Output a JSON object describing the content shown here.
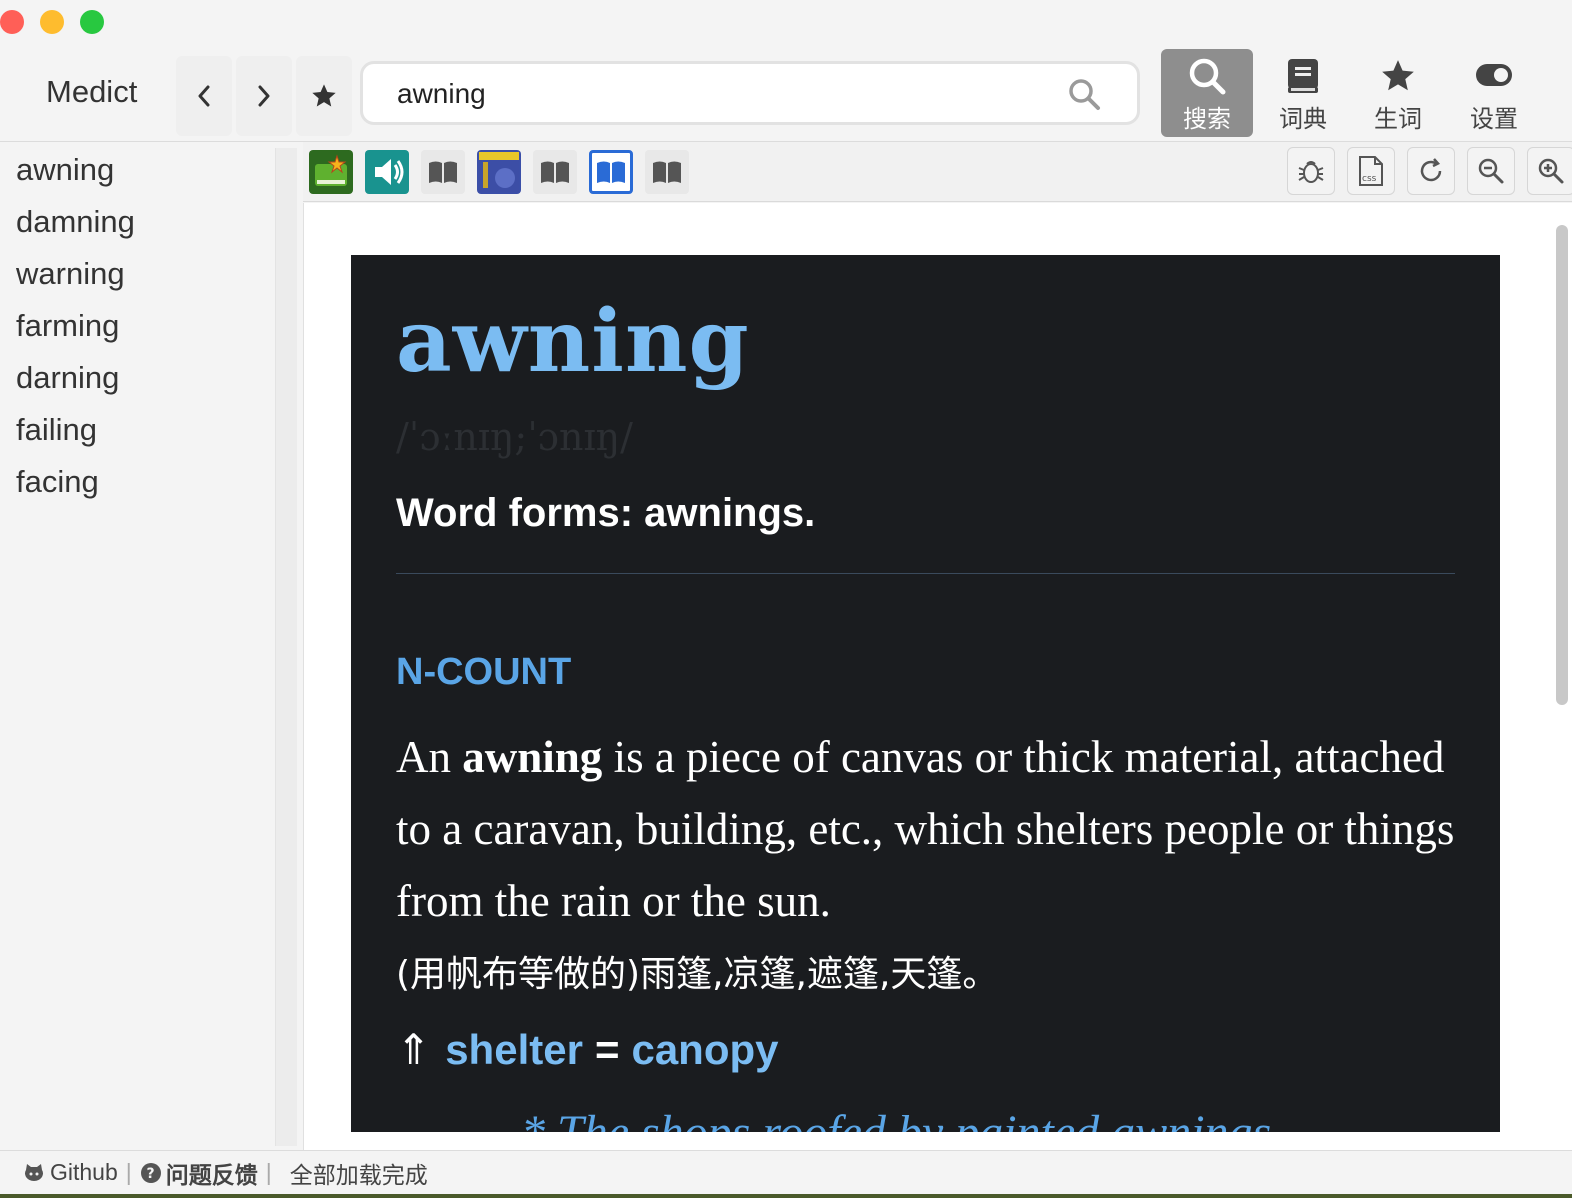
{
  "app": {
    "title": "Medict"
  },
  "search": {
    "value": "awning",
    "placeholder": ""
  },
  "modes": [
    {
      "label": "搜索",
      "icon": "search-icon",
      "active": true
    },
    {
      "label": "词典",
      "icon": "book-icon",
      "active": false
    },
    {
      "label": "生词",
      "icon": "star-icon",
      "active": false
    },
    {
      "label": "设置",
      "icon": "toggle-icon",
      "active": false
    }
  ],
  "word_list": [
    "awning",
    "damning",
    "warning",
    "farming",
    "darning",
    "failing",
    "facing"
  ],
  "entry": {
    "headword": "awning",
    "phonetic": "/ˈɔːnɪŋ;ˈɔnɪŋ/",
    "word_forms": "Word forms: awnings.",
    "part_of_speech": "N-COUNT",
    "definition_pre": "An ",
    "definition_bold": "awning",
    "definition_post": " is a piece of canvas or thick material, attached to a caravan, building, etc., which shelters people or things from the rain or the sun.",
    "translation": "(用帆布等做的)雨篷,凉篷,遮篷,天篷。",
    "synonym_arrow": "⇑",
    "synonym_1": "shelter",
    "synonym_eq": "=",
    "synonym_2": "canopy",
    "example_partial": "* The shops roofed by painted awnings"
  },
  "status": {
    "github": "Github",
    "feedback": "问题反馈",
    "sep": "|",
    "message": "全部加载完成"
  },
  "colors": {
    "headword": "#7bbcf2",
    "pos": "#5aa5e6",
    "card_bg": "#1a1c1f",
    "active_mode": "#8e8e8e",
    "selected_dict": "#2a6bd6"
  }
}
